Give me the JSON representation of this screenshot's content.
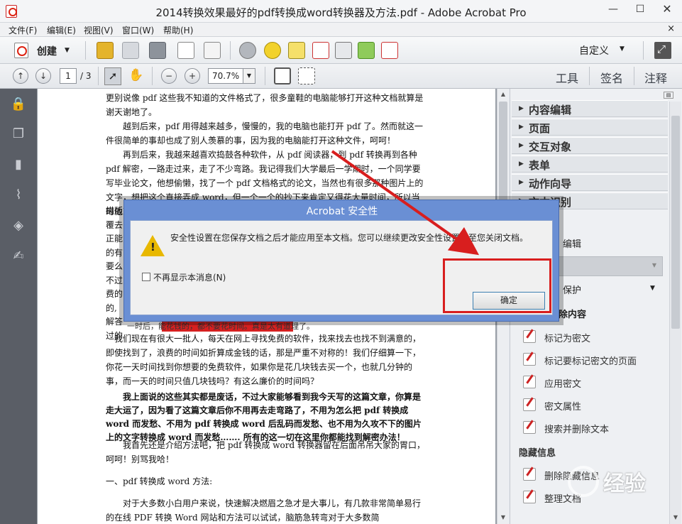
{
  "window": {
    "title": "2014转换效果最好的pdf转换成word转换器及方法.pdf - Adobe Acrobat Pro",
    "minimize": "—",
    "maximize": "☐",
    "close": "✕"
  },
  "menubar": {
    "items": [
      "文件(F)",
      "编辑(E)",
      "视图(V)",
      "窗口(W)",
      "帮助(H)"
    ],
    "close": "×"
  },
  "toolbar": {
    "create_label": "创建",
    "create_arrow": "▼",
    "customize_label": "自定义",
    "customize_arrow": "▼",
    "icons": [
      "open-icon",
      "save-icon",
      "print-icon",
      "edit-icon",
      "email-icon",
      "gear-icon",
      "comment-icon",
      "highlight-icon",
      "stamp-icon",
      "search-icon",
      "export-icon",
      "form-icon",
      "expand-icon"
    ]
  },
  "navbar": {
    "prev_page": "↑",
    "next_page": "↓",
    "current_page": "1",
    "page_total": "/ 3",
    "zoom_out": "−",
    "zoom_in": "+",
    "zoom_value": "70.7%",
    "zoom_drop": "▼",
    "links": [
      "工具",
      "签名",
      "注释"
    ]
  },
  "document": {
    "paragraphs": [
      {
        "text": "更别说像 pdf 这些我不知道的文件格式了，很多童鞋的电脑能够打开这种文档就算是谢天谢地了。",
        "bold": false
      },
      {
        "text": "越到后来，pdf 用得越来越多，慢慢的，我的电脑也能打开 pdf 了。然而就这一件很简单的事却也成了别人羡慕的事，因为我的电脑能打开这种文件，呵呵！",
        "bold": false
      },
      {
        "text": "再到后来，我越来越喜欢捣鼓各种软件，从 pdf 阅读器，到 pdf 转换再到各种 pdf 解密，一路走过来，走了不少弯路。我记得我们大学最后一学期时，一个同学要写毕业论文，他想偷懒，找了一个 pdf 文档格式的论文，当然也有很多那种图片上的文字，想把这个直接弄成 word，但一个一个的抄下来肯定又得花大量时间，所以当时他就问我能不能把图片上的文字转换成 word，还有就是把扫描版",
        "bold": false
      },
      {
        "text": "我们现在有很大一批人，每天在网上寻找免费的软件，找来找去也找不到满意的，即使找到了，浪费的时间如折算成金钱的话，那是严重不对称的！我们仔细算一下，你花一天时间找到你想要的免费软件，如果你是花几块钱去买一个，也就几分钟的事，而一天的时间只值几块钱吗？有这么廉价的时间吗？",
        "bold": false
      },
      {
        "text": "我上面说的这些其实都是废话，不过大家能够看到我今天写的这篇文章，你算是走大运了，因为看了这篇文章后你不用再去走弯路了，不用为怎么把 pdf 转换成 word 而发愁、不用为 pdf 转换成 word 后乱码而发愁、也不用为久攻不下的图片上的文字转换成 word 而发愁……. 所有的这一切在这里你都能找到解密办法！",
        "bold": true
      },
      {
        "text": "我首先还是介绍方法吧，把 pdf 转换成 word 转换器留在后面吊吊大家的胃口，呵呵！别骂我哈！",
        "bold": false
      },
      {
        "text": "一、pdf 转换成 word 方法:",
        "bold": false
      },
      {
        "text": "对于大多数小白用户来说，快速解决燃眉之急才是大事儿，有几款非常简单易行的在线 PDF 转换 Word 网站和方法可以试试，脑筋急转弯对于大多数简",
        "bold": false
      }
    ],
    "left_fragments": [
      "描版",
      "覆去",
      "正能",
      "的有",
      "要么",
      "不过",
      "费的",
      "的,",
      "解答",
      "过的"
    ],
    "fragment_line": "一时后，能花钱的，都不要花时间。真是太有道理了。"
  },
  "leftnav": {
    "icons": [
      "lock-icon",
      "pages-icon",
      "bookmark-icon",
      "attachment-icon",
      "layers-icon",
      "signature-icon"
    ]
  },
  "rightpanel": {
    "sections": [
      "内容编辑",
      "页面",
      "交互对象",
      "表单",
      "动作向导",
      "文本识别"
    ],
    "partial_items": [
      "编辑",
      "保护",
      "除内容"
    ],
    "protect_arrow": "▼",
    "items": [
      "标记为密文",
      "标记要标记密文的页面",
      "应用密文",
      "密文属性",
      "搜索并删除文本"
    ],
    "hidden_info_header": "隐藏信息",
    "hidden_items": [
      "删除隐藏信息",
      "整理文档"
    ]
  },
  "dialog": {
    "title": "Acrobat 安全性",
    "message": "安全性设置在您保存文档之后才能应用至本文档。您可以继续更改安全性设置直至您关闭文档。",
    "checkbox_label": "不再显示本消息(N)",
    "ok_button": "确定"
  },
  "watermark": {
    "text": "经验",
    "logo": "Bai"
  },
  "colors": {
    "dialog_title": "#6a8fd4",
    "annotation_red": "#d81e1e",
    "left_nav": "#5a5e66"
  }
}
